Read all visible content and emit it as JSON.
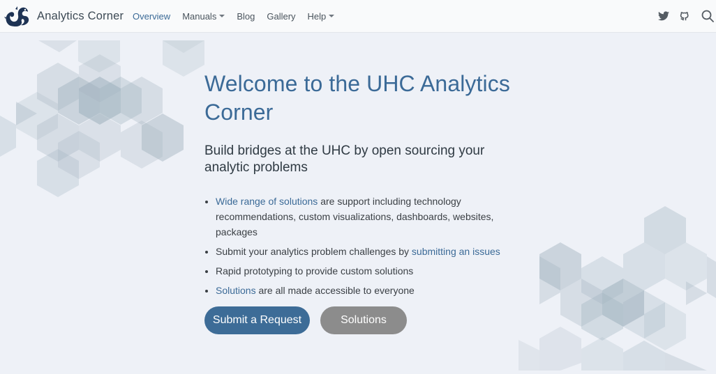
{
  "nav": {
    "brand": "Analytics Corner",
    "links": [
      {
        "label": "Overview",
        "active": true
      },
      {
        "label": "Manuals",
        "dropdown": true
      },
      {
        "label": "Blog"
      },
      {
        "label": "Gallery"
      },
      {
        "label": "Help",
        "dropdown": true
      }
    ],
    "icons": [
      "twitter-icon",
      "github-icon",
      "search-icon"
    ]
  },
  "hero": {
    "title": "Welcome to the UHC Analytics Corner",
    "subtitle": "Build bridges at the UHC by open sourcing your analytic problems",
    "features": [
      {
        "link": "Wide range of solutions",
        "text": " are support including technology recommendations, custom visualizations, dashboards, websites, packages"
      },
      {
        "prefix": "Submit your analytics problem challenges by ",
        "link": "submitting an issues"
      },
      {
        "text": "Rapid prototyping to provide custom solutions"
      },
      {
        "link": "Solutions",
        "text": " are all made accessible to everyone"
      }
    ],
    "primary_button": "Submit a Request",
    "secondary_button": "Solutions"
  },
  "colors": {
    "accent": "#3b6a97",
    "background": "#eef1f7",
    "secondary_button": "#8c8c8c",
    "hex_pattern": "#9fb1bd"
  }
}
